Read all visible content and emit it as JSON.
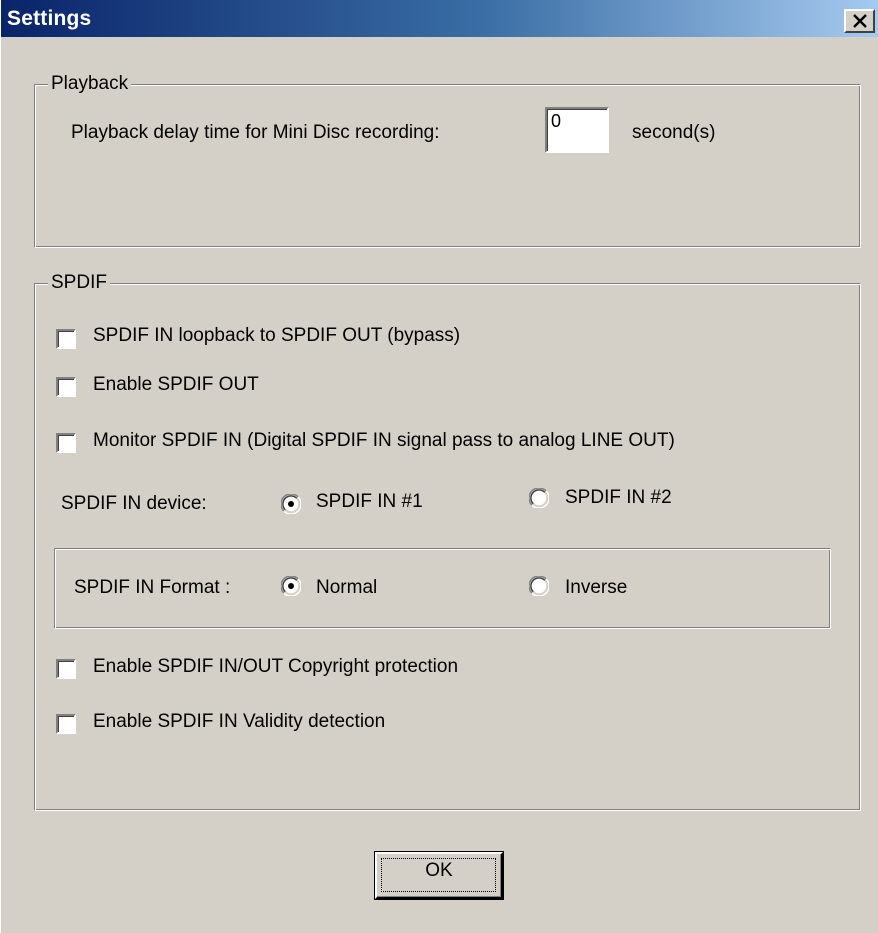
{
  "window": {
    "title": "Settings"
  },
  "playback": {
    "group_label": "Playback",
    "delay_label": "Playback delay time for Mini Disc recording:",
    "delay_value": "0",
    "delay_unit": "second(s)"
  },
  "spdif": {
    "group_label": "SPDIF",
    "loopback_label": "SPDIF IN loopback to SPDIF OUT (bypass)",
    "loopback_checked": false,
    "enable_out_label": "Enable SPDIF OUT",
    "enable_out_checked": false,
    "monitor_label": "Monitor SPDIF IN  (Digital SPDIF IN signal pass to analog LINE OUT)",
    "monitor_checked": false,
    "device_label": "SPDIF IN device:",
    "device_options": [
      "SPDIF IN #1",
      "SPDIF IN #2"
    ],
    "device_selected": "SPDIF IN #1",
    "format_label": "SPDIF IN Format :",
    "format_options": [
      "Normal",
      "Inverse"
    ],
    "format_selected": "Normal",
    "copyright_label": "Enable SPDIF IN/OUT Copyright protection",
    "copyright_checked": false,
    "validity_label": "Enable SPDIF IN Validity detection",
    "validity_checked": false
  },
  "buttons": {
    "ok_label": "OK"
  },
  "icons": {
    "close": "close-icon",
    "radio_selected": "radio-selected-icon",
    "radio_unselected": "radio-unselected-icon"
  },
  "colors": {
    "face": "#d4d0c8",
    "title_start": "#0a246a",
    "title_end": "#a6caf0"
  }
}
